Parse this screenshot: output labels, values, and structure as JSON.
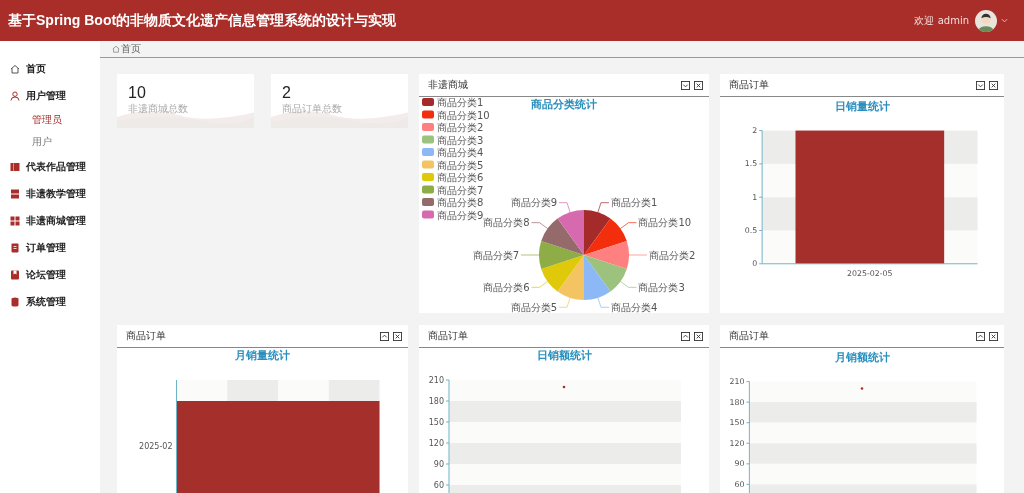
{
  "header": {
    "title": "基于Spring Boot的非物质文化遗产信息管理系统的设计与实现",
    "welcome": "欢迎 admin"
  },
  "sidebar": {
    "items": [
      {
        "label": "首页",
        "selected": false
      },
      {
        "label": "用户管理",
        "selected": false,
        "children": [
          {
            "label": "管理员",
            "selected": true
          },
          {
            "label": "用户",
            "selected": false
          }
        ]
      },
      {
        "label": "代表作品管理",
        "selected": false
      },
      {
        "label": "非遗教学管理",
        "selected": false
      },
      {
        "label": "非遗商城管理",
        "selected": false
      },
      {
        "label": "订单管理",
        "selected": false
      },
      {
        "label": "论坛管理",
        "selected": false
      },
      {
        "label": "系统管理",
        "selected": false
      }
    ]
  },
  "breadcrumb": [
    "首页"
  ],
  "stats": [
    {
      "value": "10",
      "label": "非遗商城总数"
    },
    {
      "value": "2",
      "label": "商品订单总数"
    }
  ],
  "panels": [
    {
      "title": "非遗商城",
      "kind": "pie",
      "chart_title": "商品分类统计",
      "legend": [
        {
          "label": "商品分类1",
          "color": "#a52a2a"
        },
        {
          "label": "商品分类10",
          "color": "#f22e0c"
        },
        {
          "label": "商品分类2",
          "color": "#ff8080"
        },
        {
          "label": "商品分类3",
          "color": "#9cc27e"
        },
        {
          "label": "商品分类4",
          "color": "#8cb8f5"
        },
        {
          "label": "商品分类5",
          "color": "#f5c462"
        },
        {
          "label": "商品分类6",
          "color": "#e0c90b"
        },
        {
          "label": "商品分类7",
          "color": "#8fad47"
        },
        {
          "label": "商品分类8",
          "color": "#946a6a"
        },
        {
          "label": "商品分类9",
          "color": "#d76aaf"
        }
      ],
      "slice_labels_right": [
        "商品分类1",
        "商品分类10",
        "商品分类2",
        "商品分类3",
        "商品分类4"
      ],
      "slice_labels_left": [
        "商品分类9",
        "商品分类8",
        "商品分类7",
        "商品分类6",
        "商品分类5"
      ]
    },
    {
      "title": "商品订单",
      "kind": "bar",
      "chart_data": {
        "type": "bar",
        "title": "日销量统计",
        "categories": [
          "2025-02-05"
        ],
        "series": [
          {
            "color": "#a52f2b",
            "values": [
              2
            ]
          }
        ],
        "ylim": [
          0,
          2
        ],
        "yticks": [
          0,
          {
            "value": 0.5,
            "label": "0.5"
          },
          1,
          {
            "value": 1.5,
            "label": "1.5"
          },
          2
        ]
      }
    },
    {
      "title": "商品订单",
      "kind": "hbar",
      "chart_title": "月销量统计",
      "category": "2025-02"
    },
    {
      "title": "商品订单",
      "kind": "scatter",
      "chart_title": "日销额统计",
      "y_labels": [
        "210",
        "180",
        "150",
        "120",
        "90",
        "60"
      ]
    },
    {
      "title": "商品订单",
      "kind": "scatter",
      "chart_title": "月销额统计",
      "y_labels": [
        "210",
        "180",
        "150",
        "120",
        "90",
        "60"
      ]
    }
  ]
}
